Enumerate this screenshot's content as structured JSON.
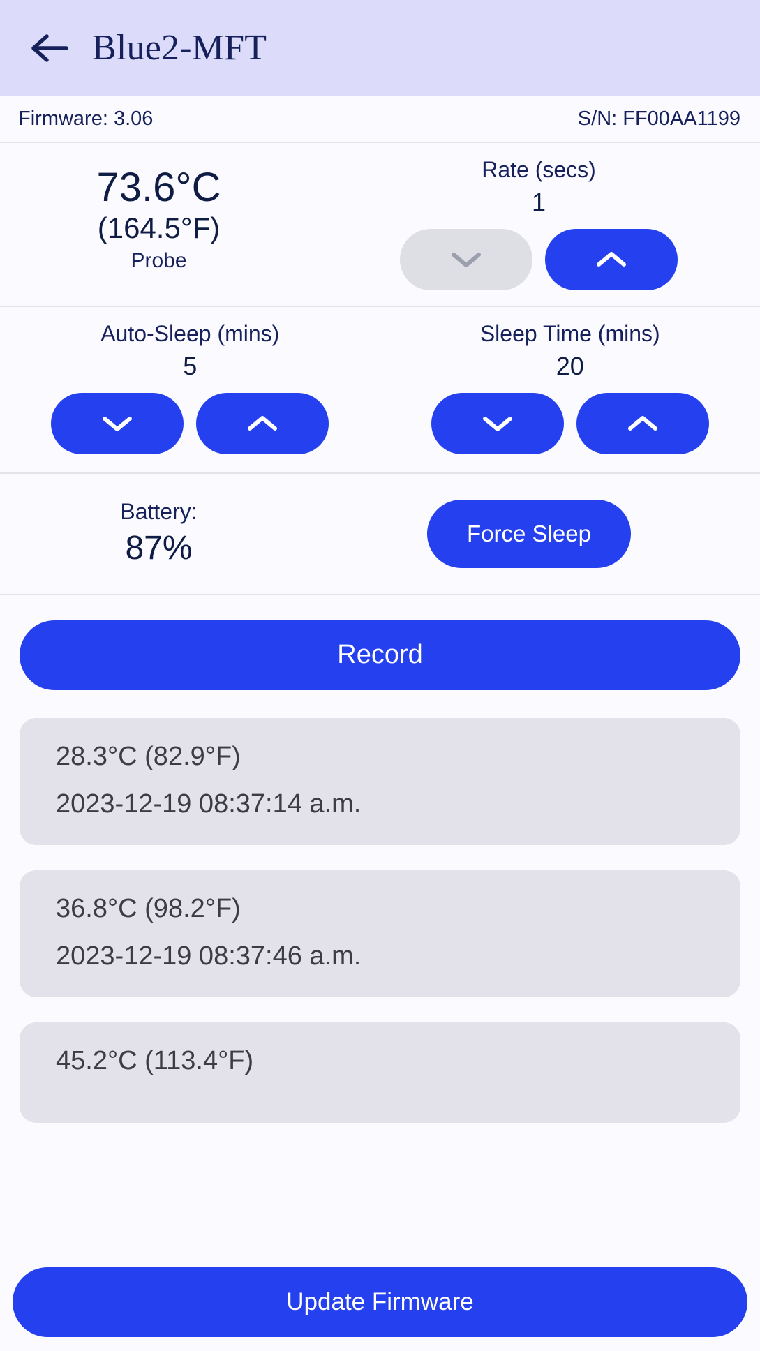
{
  "appbar": {
    "back_icon": "arrow-left-icon",
    "title": "Blue2-MFT"
  },
  "device_info": {
    "firmware": "Firmware: 3.06",
    "serial": "S/N: FF00AA1199"
  },
  "temperature": {
    "celsius": "73.6°C",
    "fahrenheit": "(164.5°F)",
    "source_label": "Probe"
  },
  "rate": {
    "title": "Rate (secs)",
    "value": "1",
    "decrement_icon": "chevron-down-icon",
    "increment_icon": "chevron-up-icon",
    "decrement_disabled": true
  },
  "auto_sleep": {
    "title": "Auto-Sleep (mins)",
    "value": "5",
    "decrement_icon": "chevron-down-icon",
    "increment_icon": "chevron-up-icon"
  },
  "sleep_time": {
    "title": "Sleep Time (mins)",
    "value": "20",
    "decrement_icon": "chevron-down-icon",
    "increment_icon": "chevron-up-icon"
  },
  "battery": {
    "label": "Battery:",
    "value": "87%"
  },
  "actions": {
    "force_sleep": "Force Sleep",
    "record": "Record",
    "update_firmware": "Update Firmware"
  },
  "records": [
    {
      "temp": "28.3°C (82.9°F)",
      "timestamp": "2023-12-19 08:37:14 a.m."
    },
    {
      "temp": "36.8°C (98.2°F)",
      "timestamp": "2023-12-19 08:37:46 a.m."
    },
    {
      "temp": "45.2°C (113.4°F)",
      "timestamp": ""
    }
  ],
  "colors": {
    "accent": "#2540ef",
    "appbar_bg": "#dcdcfa",
    "page_bg": "#fbfaff",
    "text": "#0f1c44",
    "disabled_button": "#dedfe4",
    "record_card_bg": "#e3e2ea"
  }
}
